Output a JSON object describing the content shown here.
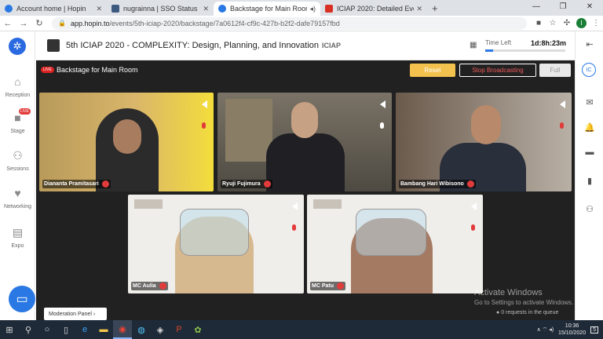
{
  "browser": {
    "tabs": [
      {
        "title": "Account home | Hopin",
        "color": "#2a78e4"
      },
      {
        "title": "nugrainna | SSO Status",
        "color": "#3d5a80"
      },
      {
        "title": "Backstage for Main Room",
        "color": "#2a78e4"
      },
      {
        "title": "ICIAP 2020: Detailed Event Inform",
        "color": "#d93025"
      }
    ],
    "url_host": "app.hopin.to",
    "url_path": "/events/5th-iciap-2020/backstage/7a0612f4-cf9c-427b-b2f2-dafe79157fbd",
    "profile_initial": "I"
  },
  "sidebar": {
    "items": [
      {
        "label": "Reception",
        "icon": "home-icon"
      },
      {
        "label": "Stage",
        "icon": "camera-icon",
        "badge": "LIVE"
      },
      {
        "label": "Sessions",
        "icon": "people-icon"
      },
      {
        "label": "Networking",
        "icon": "handshake-icon"
      },
      {
        "label": "Expo",
        "icon": "store-icon"
      }
    ]
  },
  "event": {
    "title": "5th ICIAP 2020 - COMPLEXITY: Design, Planning, and Innovation",
    "tag": "ICIAP",
    "time_left_label": "Time Left",
    "time_left": "1d:8h:23m",
    "time_progress": 0.1
  },
  "user_initials": "IC",
  "backstage": {
    "live": "LIVE",
    "title": "Backstage for Main Room",
    "reset": "Reset",
    "stop": "Stop Broadcasting",
    "full": "Full"
  },
  "speakers": [
    {
      "name": "Diananta Pramitasari"
    },
    {
      "name": "Ryuji Fujimura"
    },
    {
      "name": "Bambang Hari Wibisono"
    },
    {
      "name": "MC Aulia"
    },
    {
      "name": "MC Patu"
    }
  ],
  "moderation": "Moderation Panel",
  "watermark": {
    "line1": "Activate Windows",
    "line2": "Go to Settings to activate Windows."
  },
  "queue": "0 requests in the queue",
  "clock": {
    "time": "10:36",
    "date": "15/10/2020"
  },
  "notif_count": "5"
}
